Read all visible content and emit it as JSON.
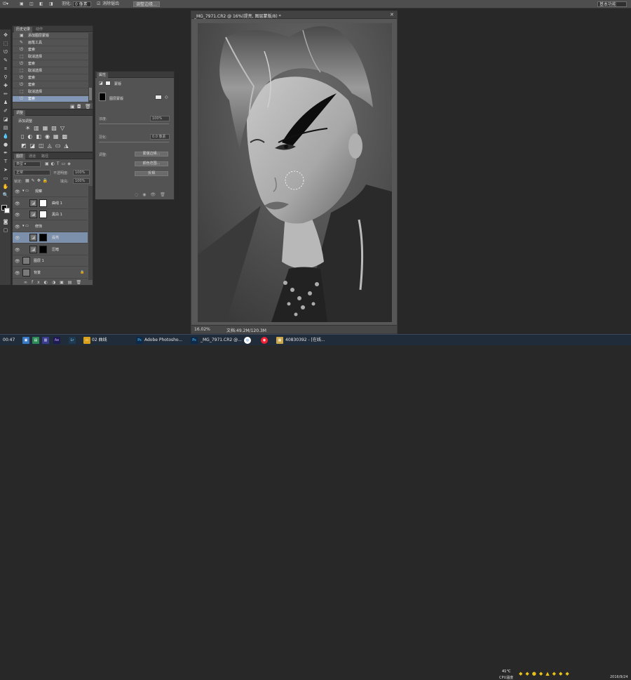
{
  "options_bar": {
    "feather_label": "羽化:",
    "feather_value": "0 像素",
    "antialias_label": "消除锯齿",
    "refine_edge_label": "调整边缘...",
    "workspace_label": "基本功能"
  },
  "history_panel": {
    "tabs": [
      "历史记录",
      "动作"
    ],
    "items": [
      {
        "icon": "snapshot-icon",
        "label": "添加图层蒙版"
      },
      {
        "icon": "brush-icon",
        "label": "画笔工具"
      },
      {
        "icon": "lasso-icon",
        "label": "套索"
      },
      {
        "icon": "selection-icon",
        "label": "取消选择"
      },
      {
        "icon": "lasso-icon",
        "label": "套索"
      },
      {
        "icon": "selection-icon",
        "label": "取消选择"
      },
      {
        "icon": "lasso-icon",
        "label": "套索"
      },
      {
        "icon": "lasso-icon",
        "label": "套索"
      },
      {
        "icon": "selection-icon",
        "label": "取消选择"
      },
      {
        "icon": "lasso-icon",
        "label": "套索"
      }
    ]
  },
  "adjustments_panel": {
    "tab": "调整",
    "title": "添加调整"
  },
  "layers_panel": {
    "tabs": [
      "图层",
      "通道",
      "路径"
    ],
    "kind_label": "类型",
    "blend_mode": "正常",
    "opacity_label": "不透明度:",
    "opacity_value": "100%",
    "lock_label": "锁定:",
    "fill_label": "填充:",
    "fill_value": "100%",
    "layers": [
      {
        "type": "group",
        "name": "观察"
      },
      {
        "type": "adjust",
        "name": "曲线 1"
      },
      {
        "type": "adjust",
        "name": "黑白 1"
      },
      {
        "type": "group",
        "name": "修饰"
      },
      {
        "type": "adjust",
        "name": "提亮",
        "selected": true
      },
      {
        "type": "adjust",
        "name": "压暗"
      },
      {
        "type": "image",
        "name": "图层 1"
      },
      {
        "type": "image",
        "name": "背景"
      }
    ]
  },
  "properties_panel": {
    "tab": "属性",
    "subtitle": "蒙版",
    "mask_label": "图层蒙版",
    "density_label": "浓度:",
    "density_value": "100%",
    "feather_label": "羽化:",
    "feather_value": "0.0 像素",
    "refine_label": "调整:",
    "mask_edge_button": "蒙版边缘...",
    "color_range_button": "颜色范围...",
    "invert_button": "反相"
  },
  "document": {
    "title": "_MG_7971.CR2 @ 16%(提亮, 图层蒙版/8) *",
    "zoom": "16.02%",
    "doc_info": "文档:49.2M/120.3M"
  },
  "taskbar": {
    "time": "00:47",
    "apps": [
      {
        "label": "02 曲线"
      },
      {
        "label": "Adobe Photosho..."
      },
      {
        "label": "_MG_7971.CR2 @..."
      },
      {
        "label": "408303​92 - [在线..."
      }
    ],
    "cpu_temp": "41°C",
    "cpu_label": "CPU温度",
    "date": "2016/9/24"
  }
}
